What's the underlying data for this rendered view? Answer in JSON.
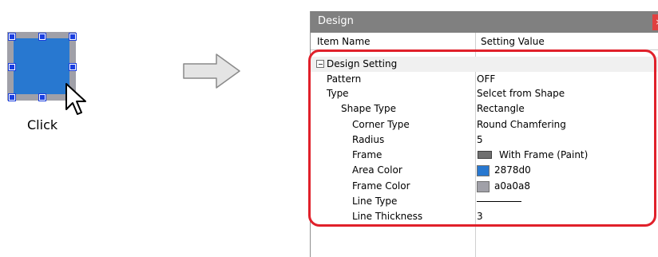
{
  "illustration": {
    "click_label": "Click",
    "area_color": "#2878d0",
    "frame_color": "#a0a0a8",
    "handle_color": "#1a3fe0"
  },
  "panel": {
    "title": "Design",
    "close_icon": "close-icon",
    "columns": {
      "item": "Item Name",
      "value": "Setting Value"
    },
    "category": "Design Setting",
    "rows": [
      {
        "name": "Pattern",
        "value": "OFF"
      },
      {
        "name": "Type",
        "value": "Selcet from Shape"
      },
      {
        "name": "Shape Type",
        "value": "Rectangle"
      },
      {
        "name": "Corner Type",
        "value": "Round Chamfering"
      },
      {
        "name": "Radius",
        "value": "5"
      },
      {
        "name": "Frame",
        "value": "With Frame (Paint)"
      },
      {
        "name": "Area Color",
        "value": "2878d0"
      },
      {
        "name": "Frame Color",
        "value": "a0a0a8"
      },
      {
        "name": "Line Type",
        "value": ""
      },
      {
        "name": "Line Thickness",
        "value": "3"
      }
    ],
    "colors": {
      "area": "#2878d0",
      "frame": "#a0a0a8",
      "highlight": "#e0202a"
    }
  }
}
